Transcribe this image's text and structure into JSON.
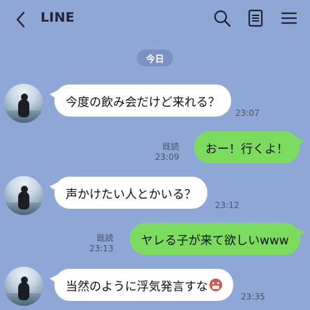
{
  "header": {
    "title": "LINE",
    "back_icon": "chevron-left-icon",
    "search_icon": "search-icon",
    "notes_icon": "notes-icon",
    "menu_icon": "menu-icon"
  },
  "date_label": "今日",
  "messages": [
    {
      "side": "left",
      "text": "今度の飲み会だけど来れる？",
      "time": "23:07"
    },
    {
      "side": "right",
      "text": "おー！行くよ！",
      "read": "既読",
      "time": "23:09"
    },
    {
      "side": "left",
      "text": "声かけたい人とかいる？",
      "time": "23:12"
    },
    {
      "side": "right",
      "text": "ヤレる子が来て欲しいwww",
      "read": "既読",
      "time": "23:13"
    },
    {
      "side": "left",
      "text": "当然のように浮気発言すな",
      "time": "23:35",
      "emoji": "angry-face-icon"
    }
  ],
  "colors": {
    "background": "#8fa7d6",
    "bubble_left": "#ffffff",
    "bubble_right": "#7bdc5e",
    "date_pill": "#7c92c4"
  }
}
